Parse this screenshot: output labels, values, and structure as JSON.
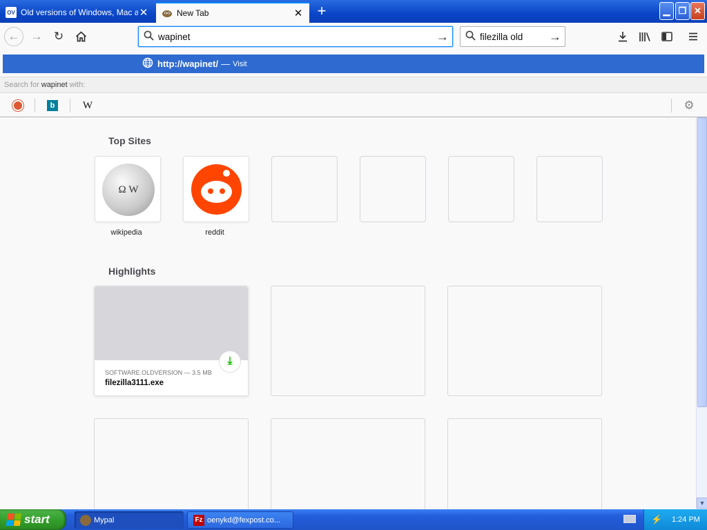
{
  "tabs": [
    {
      "label": "Old versions of Windows, Mac and",
      "favicon": "OV"
    },
    {
      "label": "New Tab"
    }
  ],
  "urlbar": {
    "value": "wapinet"
  },
  "searchbar": {
    "value": "filezilla old"
  },
  "popup": {
    "suggestion_url": "http://wapinet/",
    "suggestion_sep": "—",
    "suggestion_action": "Visit",
    "search_for_prefix": "Search for",
    "search_for_query": "wapinet",
    "search_for_suffix": "with:",
    "engine_wiki_glyph": "W",
    "engine_bing_glyph": "b"
  },
  "content": {
    "top_sites_title": "Top Sites",
    "top_sites": [
      {
        "label": "wikipedia"
      },
      {
        "label": "reddit"
      }
    ],
    "wiki_glyph": "Ω W",
    "highlights_title": "Highlights",
    "highlight": {
      "meta": "SOFTWARE.OLDVERSION — 3.5 MB",
      "name": "filezilla3111.exe"
    }
  },
  "taskbar": {
    "start_label": "start",
    "tasks": [
      {
        "label": "Mypal"
      },
      {
        "label": "oenykd@fexpost.co..."
      }
    ],
    "filezilla_glyph": "Fz",
    "clock": "1:24 PM"
  },
  "colors": {
    "accent": "#0a84ff",
    "suggestion_highlight": "#2e6ad0",
    "reddit": "#ff4500",
    "download_green": "#12bc00",
    "xp_blue": "#245edb",
    "xp_start_green": "#34a02d"
  }
}
